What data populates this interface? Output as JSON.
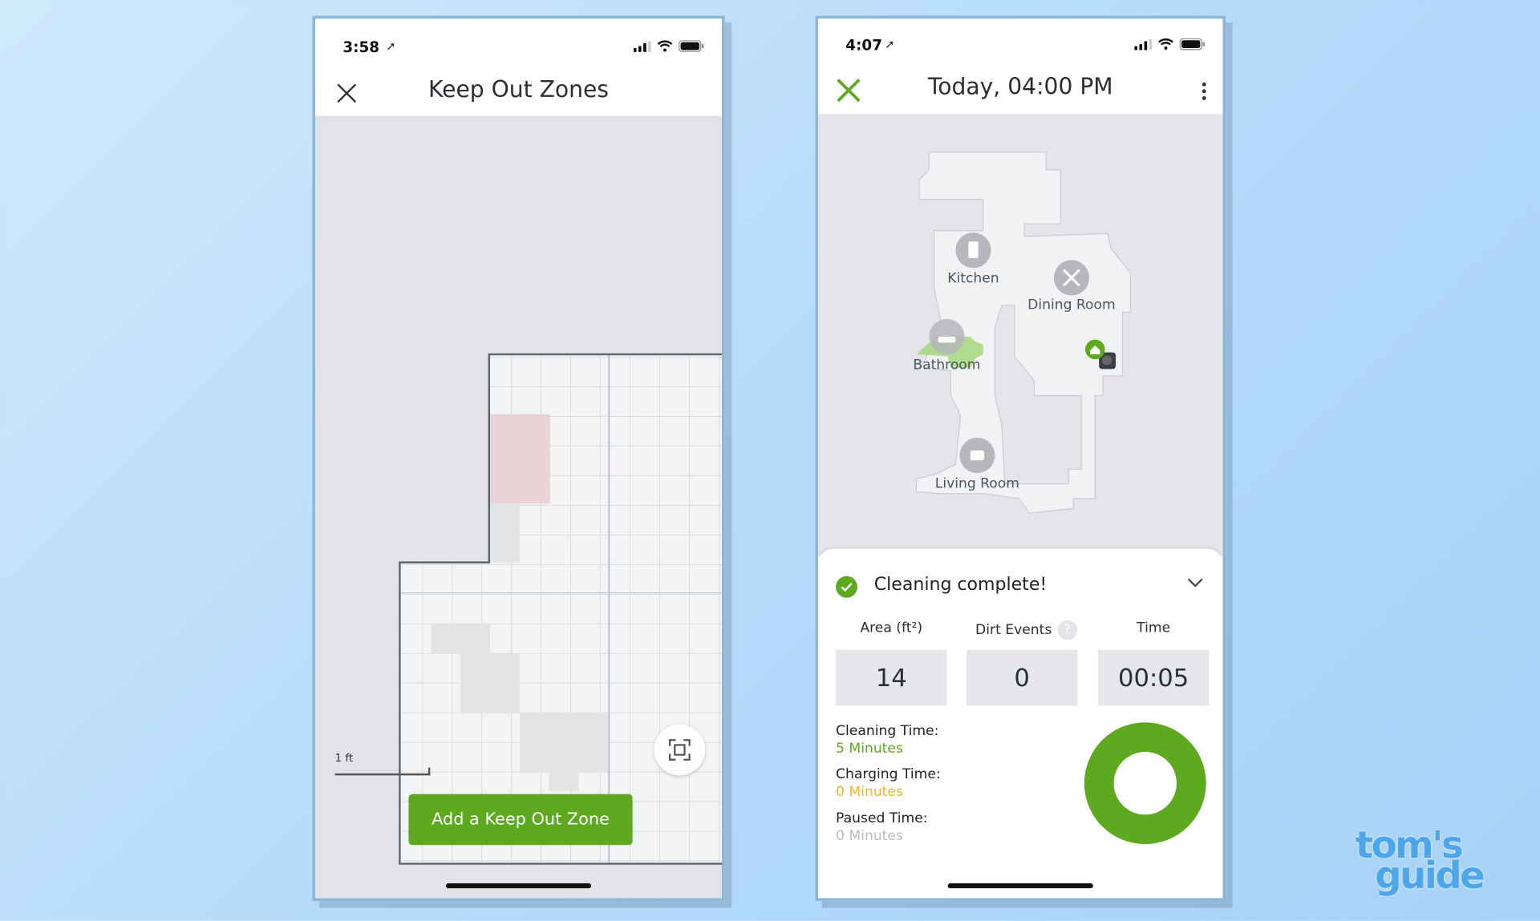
{
  "left_screen": {
    "status_time": "3:58",
    "title": "Keep Out Zones",
    "scale_label": "1 ft",
    "add_button": "Add a Keep Out Zone",
    "keep_out_zone_color": "#e8cfd3"
  },
  "right_screen": {
    "status_time": "4:07",
    "title": "Today, 04:00 PM",
    "rooms": [
      {
        "name": "Kitchen",
        "icon": "fridge-icon"
      },
      {
        "name": "Dining Room",
        "icon": "fork-spoon-icon"
      },
      {
        "name": "Bathroom",
        "icon": "bathtub-icon"
      },
      {
        "name": "Living Room",
        "icon": "armchair-icon"
      }
    ],
    "card": {
      "status": "Cleaning complete!",
      "stats": [
        {
          "label": "Area (ft²)",
          "value": "14"
        },
        {
          "label": "Dirt Events",
          "value": "0"
        },
        {
          "label": "Time",
          "value": "00:05"
        }
      ],
      "times": [
        {
          "label": "Cleaning Time:",
          "value": "5 Minutes",
          "color": "#5da91f"
        },
        {
          "label": "Charging Time:",
          "value": "0 Minutes",
          "color": "#f2b824"
        },
        {
          "label": "Paused Time:",
          "value": "0 Minutes",
          "color": "#b9bcbf"
        }
      ],
      "donut_cleaning_fraction": 1.0
    }
  },
  "brand": {
    "accent": "#5da91f"
  },
  "watermark": {
    "line1": "tom's",
    "line2": "guide"
  }
}
